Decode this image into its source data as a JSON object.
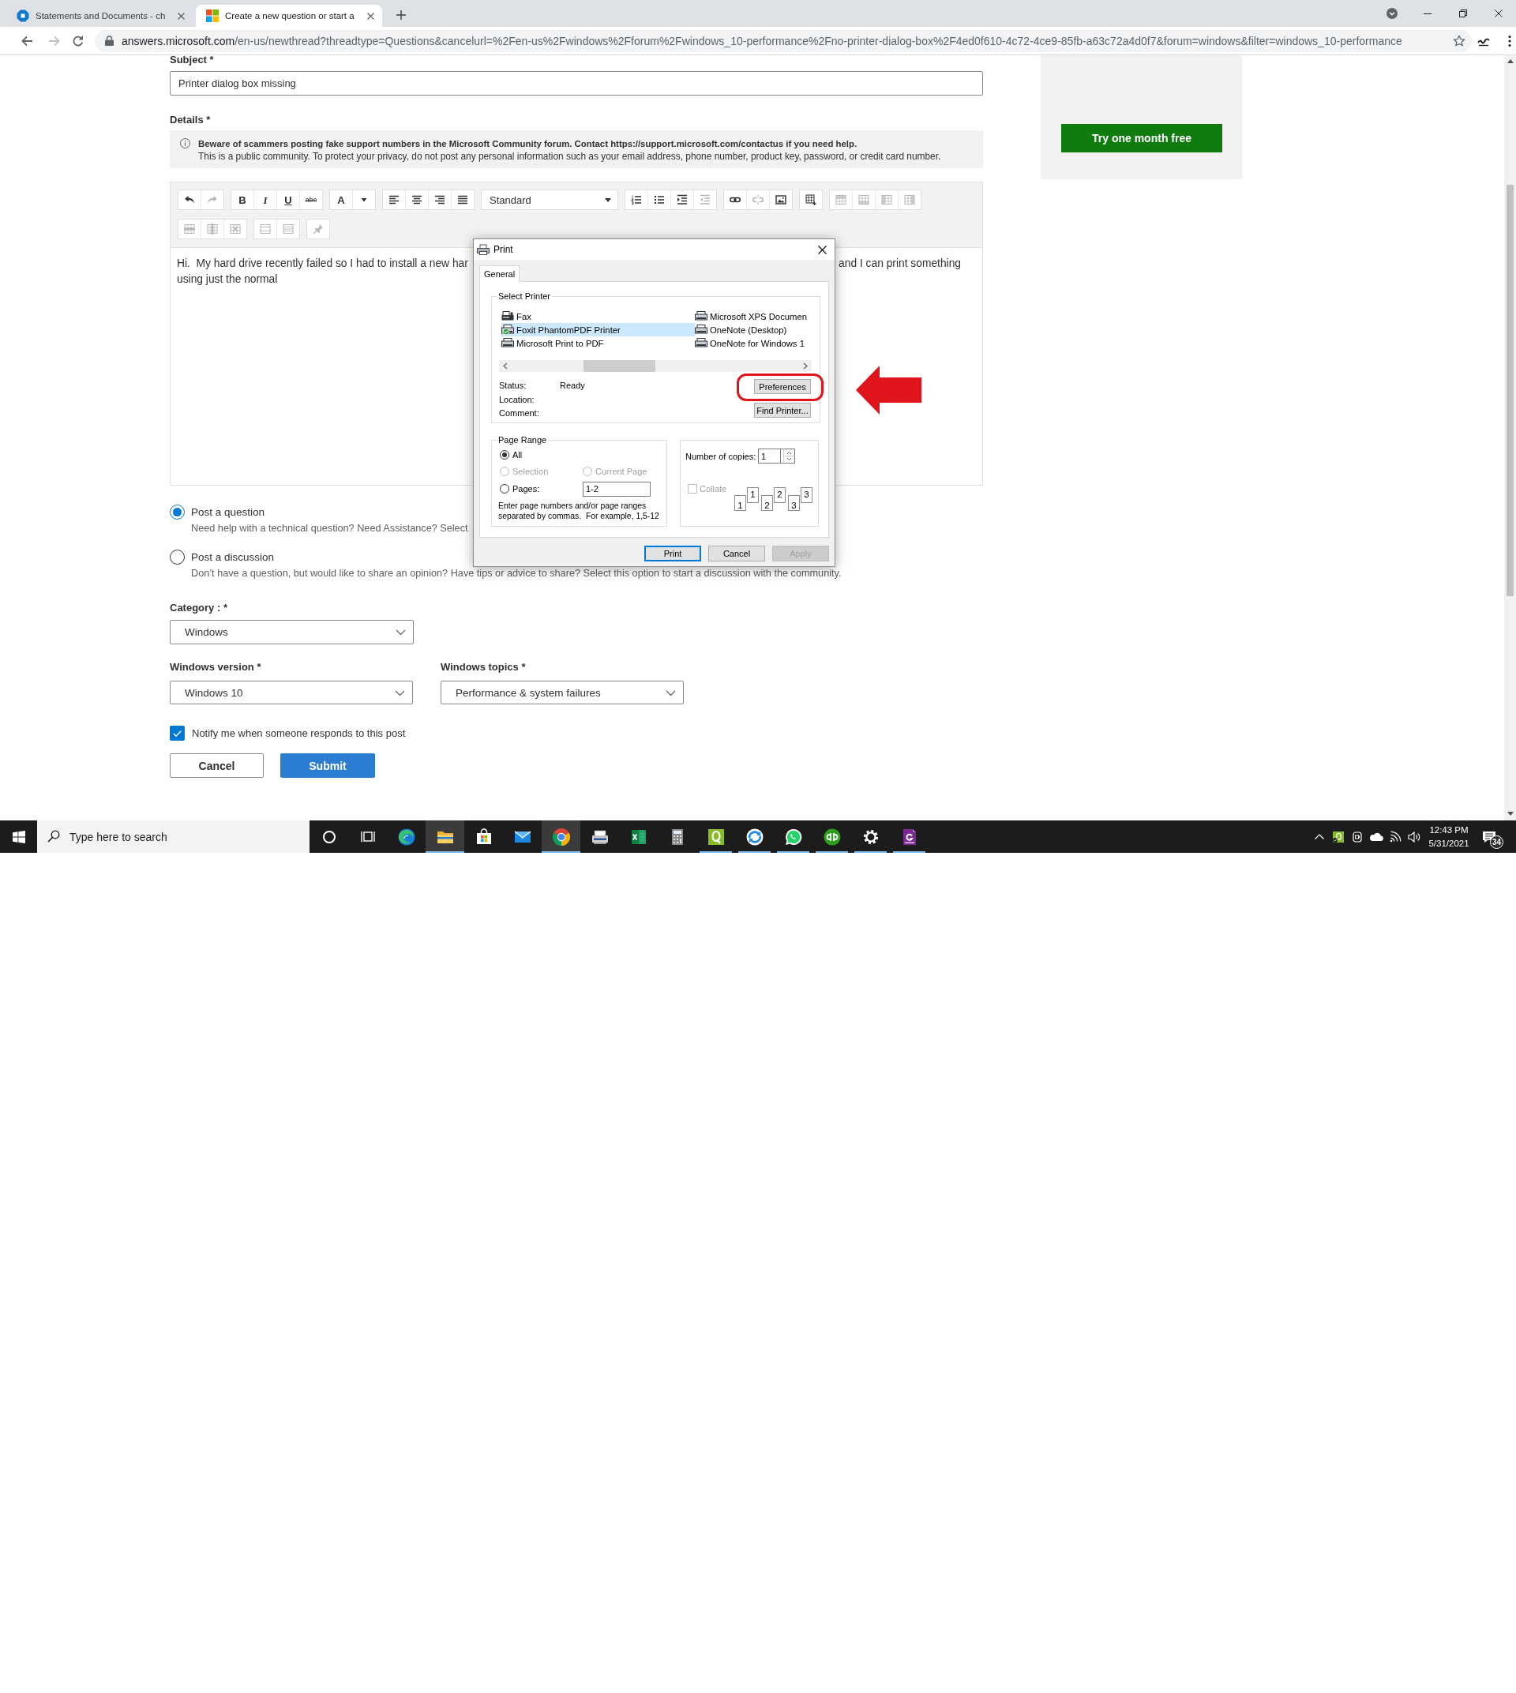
{
  "browser": {
    "tabs": [
      {
        "kind": "octagon",
        "title": "Statements and Documents - ch",
        "selected": false
      },
      {
        "kind": "squares",
        "title": "Create a new question or start a",
        "selected": true
      }
    ],
    "navigation": [
      {
        "kind": "back",
        "disabled": false
      },
      {
        "kind": "forward",
        "disabled": true
      },
      {
        "kind": "reload",
        "disabled": false
      }
    ],
    "address": {
      "host": "answers.microsoft.com",
      "path": "/en-us/newthread?threadtype=Questions&cancelurl=%2Fen-us%2Fwindows%2Fforum%2Fwindows_10-performance%2Fno-printer-dialog-box%2F4ed0f610-4c72-4ce9-85fb-a63c72a4d0f7&forum=windows&filter=windows_10-performance"
    }
  },
  "form": {
    "subject": {
      "label": "Subject *",
      "value": "Printer dialog box missing"
    },
    "details": {
      "label": "Details *",
      "warning": "Beware of scammers posting fake support numbers in the Microsoft Community forum. Contact https://support.microsoft.com/contactus if you need help.",
      "privacy": "This is a public community. To protect your privacy, do not post any personal information such as your email address, phone number, product key, password, or credit card number."
    },
    "editor": {
      "toolbar": [
        [
          {
            "kind": "group",
            "buttons": [
              {
                "kind": "undo",
                "disabled": false
              },
              {
                "kind": "redo",
                "disabled": true
              }
            ]
          },
          {
            "kind": "group",
            "buttons": [
              {
                "kind": "bold",
                "label": "B",
                "disabled": false
              },
              {
                "kind": "italic",
                "label": "I",
                "disabled": false
              },
              {
                "kind": "underline",
                "label": "U",
                "disabled": false
              },
              {
                "kind": "strike",
                "label": "abc",
                "disabled": false
              }
            ]
          },
          {
            "kind": "group",
            "buttons": [
              {
                "kind": "font-color",
                "label": "A",
                "disabled": false
              },
              {
                "kind": "caret",
                "disabled": false
              }
            ]
          },
          {
            "kind": "group",
            "buttons": [
              {
                "kind": "align-left",
                "disabled": false
              },
              {
                "kind": "align-center",
                "disabled": false
              },
              {
                "kind": "align-right",
                "disabled": false
              },
              {
                "kind": "justify",
                "disabled": false
              }
            ]
          },
          {
            "kind": "select",
            "value": "Standard"
          },
          {
            "kind": "group",
            "buttons": [
              {
                "kind": "numbered-list",
                "disabled": false
              },
              {
                "kind": "bullet-list",
                "disabled": false
              },
              {
                "kind": "indent",
                "disabled": false
              },
              {
                "kind": "outdent",
                "disabled": true
              }
            ]
          },
          {
            "kind": "group",
            "buttons": [
              {
                "kind": "link",
                "disabled": false
              },
              {
                "kind": "unlink",
                "disabled": true
              },
              {
                "kind": "image",
                "disabled": false
              }
            ]
          },
          {
            "kind": "group",
            "buttons": [
              {
                "kind": "table",
                "disabled": false
              }
            ]
          },
          {
            "kind": "group",
            "buttons": [
              {
                "kind": "row-above",
                "disabled": true
              },
              {
                "kind": "row-below",
                "disabled": true
              },
              {
                "kind": "column-left",
                "disabled": true
              },
              {
                "kind": "column-right",
                "disabled": true
              }
            ]
          }
        ],
        [
          {
            "kind": "group",
            "buttons": [
              {
                "kind": "delete-row",
                "disabled": true
              },
              {
                "kind": "delete-column",
                "disabled": true
              },
              {
                "kind": "delete-table",
                "disabled": true
              }
            ]
          },
          {
            "kind": "group",
            "buttons": [
              {
                "kind": "cell",
                "disabled": true
              },
              {
                "kind": "rows",
                "disabled": true
              }
            ]
          },
          {
            "kind": "group",
            "buttons": [
              {
                "kind": "pin",
                "disabled": true
              }
            ]
          }
        ]
      ],
      "lines": [
        {
          "start": "Hi.  My hard drive recently failed so I had to install a new har",
          "end": "and I can print something"
        },
        {
          "start": "using just the normal"
        }
      ]
    },
    "post_types": [
      {
        "label": "Post a question",
        "description": "Need help with a technical question? Need Assistance? Select",
        "selected": true
      },
      {
        "label": "Post a discussion",
        "description": "Don’t have a question, but would like to share an opinion? Have tips or advice to share? Select this option to start a discussion with the community.",
        "selected": false
      }
    ],
    "category": {
      "label": "Category : *",
      "value": "Windows"
    },
    "windows_version": {
      "label": "Windows version *",
      "value": "Windows 10"
    },
    "windows_topics": {
      "label": "Windows topics *",
      "value": "Performance & system failures"
    },
    "notify": {
      "label": "Notify me when someone responds to this post",
      "checked": true
    },
    "actions": [
      {
        "kind": "secondary",
        "label": "Cancel"
      },
      {
        "kind": "primary",
        "label": "Submit"
      }
    ]
  },
  "promo": {
    "button": "Try one month free"
  },
  "print_dialog": {
    "title": "Print",
    "tabs": [
      {
        "label": "General",
        "selected": true
      }
    ],
    "select_printer": {
      "legend": "Select Printer",
      "printers": [
        {
          "kind": "fax",
          "name": "Fax",
          "selected": false,
          "default": false
        },
        {
          "kind": "printer",
          "name": "Foxit PhantomPDF Printer",
          "selected": true,
          "default": true
        },
        {
          "kind": "printer",
          "name": "Microsoft Print to PDF",
          "selected": false,
          "default": false
        },
        {
          "kind": "printer",
          "name": "Microsoft XPS Documen",
          "selected": false,
          "default": false
        },
        {
          "kind": "printer",
          "name": "OneNote (Desktop)",
          "selected": false,
          "default": false
        },
        {
          "kind": "printer",
          "name": "OneNote for Windows 1",
          "selected": false,
          "default": false
        }
      ],
      "info": [
        {
          "label": "Status:",
          "value": "Ready"
        },
        {
          "label": "Location:"
        },
        {
          "label": "Comment:"
        }
      ],
      "buttons": [
        "Preferences",
        "Find Printer..."
      ]
    },
    "page_range": {
      "legend": "Page Range",
      "options": [
        {
          "label": "All",
          "selected": true,
          "disabled": false
        },
        {
          "label": "Selection",
          "selected": false,
          "disabled": true
        },
        {
          "label": "Current Page",
          "selected": false,
          "disabled": true
        },
        {
          "label": "Pages:",
          "selected": false,
          "disabled": false
        }
      ],
      "pages": "1-2",
      "hint": "Enter page numbers and/or page ranges separated by commas.  For example, 1,5-12"
    },
    "copies": {
      "label": "Number of copies:",
      "value": "1",
      "collate": {
        "label": "Collate",
        "checked": false,
        "disabled": true
      },
      "sample": [
        {
          "back": "1",
          "front": "1"
        },
        {
          "back": "2",
          "front": "2"
        },
        {
          "back": "3",
          "front": "3"
        }
      ]
    },
    "footer": [
      {
        "label": "Print",
        "default": true,
        "disabled": false
      },
      {
        "label": "Cancel",
        "default": false,
        "disabled": false
      },
      {
        "label": "Apply",
        "default": false,
        "disabled": true
      }
    ]
  },
  "annotations": {
    "ring": true,
    "arrow": true
  },
  "taskbar": {
    "search_placeholder": "Type here to search",
    "apps": [
      {
        "kind": "circle",
        "running": false,
        "highlighted": false
      },
      {
        "kind": "task-view",
        "running": false,
        "highlighted": false
      },
      {
        "kind": "swirl",
        "running": false,
        "highlighted": false
      },
      {
        "kind": "folder",
        "running": true,
        "highlighted": true
      },
      {
        "kind": "bag",
        "running": false,
        "highlighted": false
      },
      {
        "kind": "envelope",
        "running": false,
        "highlighted": false
      },
      {
        "kind": "browser",
        "running": true,
        "highlighted": true
      },
      {
        "kind": "scanner",
        "running": false,
        "highlighted": false
      },
      {
        "kind": "spreadsheet",
        "running": false,
        "highlighted": false
      },
      {
        "kind": "calculator",
        "running": false,
        "highlighted": false
      },
      {
        "kind": "q-tile",
        "running": true,
        "highlighted": false
      },
      {
        "kind": "arrows",
        "running": true,
        "highlighted": false
      },
      {
        "kind": "chat",
        "running": true,
        "highlighted": false
      },
      {
        "kind": "qb-circle",
        "running": true,
        "highlighted": false
      },
      {
        "kind": "gear",
        "running": true,
        "highlighted": false
      },
      {
        "kind": "pdf-tile",
        "running": true,
        "highlighted": false
      }
    ],
    "clock": {
      "time": "12:43 PM",
      "date": "5/31/2021"
    },
    "notifications": "34"
  }
}
